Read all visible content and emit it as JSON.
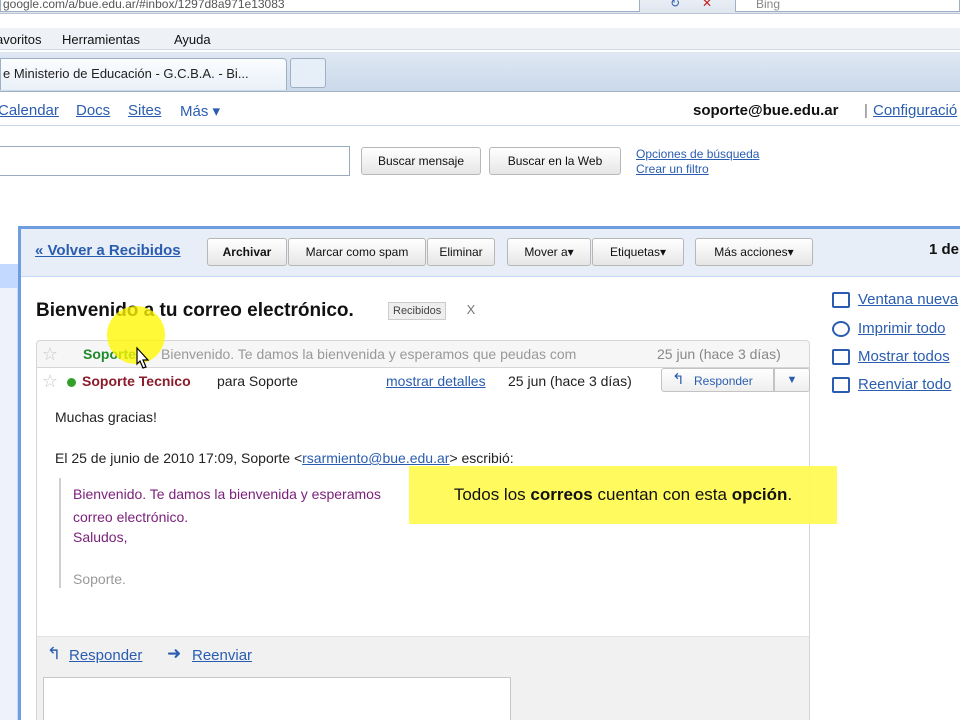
{
  "browser": {
    "url": "google.com/a/bue.edu.ar/#inbox/1297d8a971e13083",
    "search_placeholder": "Bing",
    "menu": [
      "avoritos",
      "Herramientas",
      "Ayuda"
    ],
    "tab_title": "e Ministerio de Educación - G.C.B.A. - Bi..."
  },
  "gmail": {
    "nav_links": [
      "Calendar",
      "Docs",
      "Sites",
      "Más ▾"
    ],
    "user_email": "soporte@bue.edu.ar",
    "separator": "|",
    "settings_link": "Configuració",
    "search_mail_button": "Buscar mensaje",
    "search_web_button": "Buscar en la Web",
    "search_options": "Opciones de búsqueda",
    "create_filter": "Crear un filtro"
  },
  "toolbar": {
    "back_link": "« Volver a Recibidos",
    "archive": "Archivar",
    "spam": "Marcar como spam",
    "delete": "Eliminar",
    "move": "Mover a▾",
    "labels": "Etiquetas▾",
    "more_actions": "Más acciones▾",
    "count": "1 de"
  },
  "thread": {
    "subject": "Bienvenido a tu correo electrónico.",
    "label": "Recibidos",
    "label_remove": "X",
    "side_actions": [
      "Ventana nueva",
      "Imprimir todo",
      "Mostrar todos",
      "Reenviar todo"
    ]
  },
  "collapsed_message": {
    "sender": "Soporte",
    "snippet": "Bienvenido. Te damos la bienvenida y esperamos que peudas com",
    "date": "25 jun (hace 3 días)"
  },
  "open_message": {
    "from": "Soporte Tecnico",
    "to": "para Soporte",
    "show_details": "mostrar detalles",
    "date": "25 jun (hace 3 días)",
    "reply_button": "Responder",
    "reply_dropdown": "▼",
    "body_greeting": "Muchas gracias!",
    "quote_header_prefix": "El 25 de junio de 2010 17:09, Soporte <",
    "quote_header_email": "rsarmiento@bue.edu.ar",
    "quote_header_suffix": "> escribió:",
    "quote_lines": [
      "Bienvenido. Te damos la bienvenida y esperamos",
      "correo electrónico.",
      "Saludos,"
    ],
    "quote_signature": "Soporte.",
    "footer_reply": "Responder",
    "footer_forward": "Reenviar"
  },
  "caption": {
    "part1": "Todos los ",
    "part2": "correos",
    "part3": " cuentan con esta ",
    "part4": "opción",
    "part5": "."
  },
  "icons": {
    "star": "☆",
    "reply_arrow": "↰",
    "forward_arrow": "➜"
  },
  "colors": {
    "link": "#2a5db0",
    "frame_border": "#6f9ee0",
    "sender_unread": "#1e8a2a",
    "sender_open": "#8a1c2b",
    "quoted_text": "#7a1f7a",
    "highlight": "#fff700"
  }
}
